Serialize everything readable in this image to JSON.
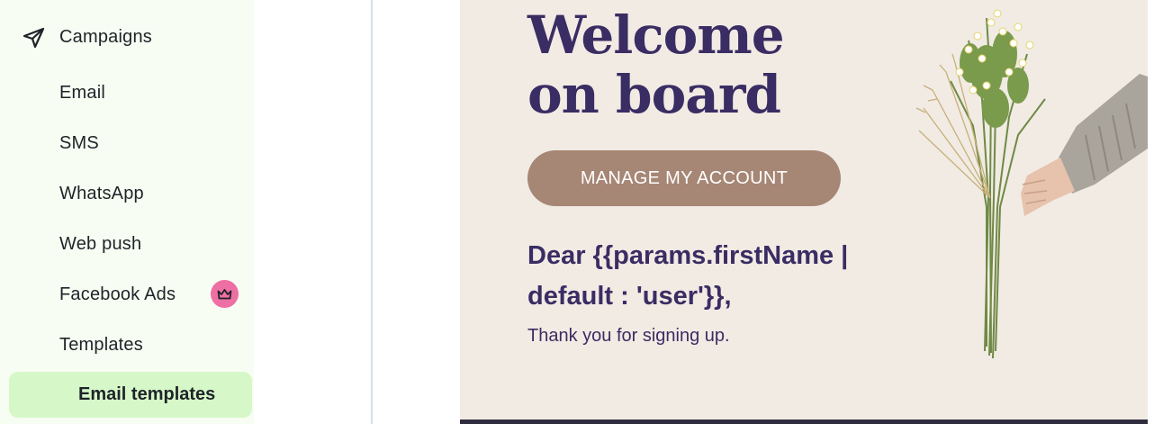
{
  "sidebar": {
    "campaigns": {
      "label": "Campaigns",
      "icon": "send-icon"
    },
    "items": [
      {
        "label": "Email"
      },
      {
        "label": "SMS"
      },
      {
        "label": "WhatsApp"
      },
      {
        "label": "Web push"
      },
      {
        "label": "Facebook Ads",
        "badge_icon": "crown-icon",
        "badge_color": "#ee6fa3"
      },
      {
        "label": "Templates"
      }
    ],
    "active_item": {
      "label": "Email templates"
    },
    "colors": {
      "background": "#f7fdf2",
      "active_background": "#d6f8c8"
    }
  },
  "email": {
    "heading": "Welcome on board",
    "button_label": "MANAGE MY ACCOUNT",
    "greeting": "Dear {{params.firstName | default : 'user'}},",
    "body_text": "Thank you for signing up.",
    "image": "hand-holding-wildflowers-bouquet",
    "colors": {
      "background": "#f1ebe4",
      "text": "#3a2d63",
      "button": "#a68674"
    }
  }
}
